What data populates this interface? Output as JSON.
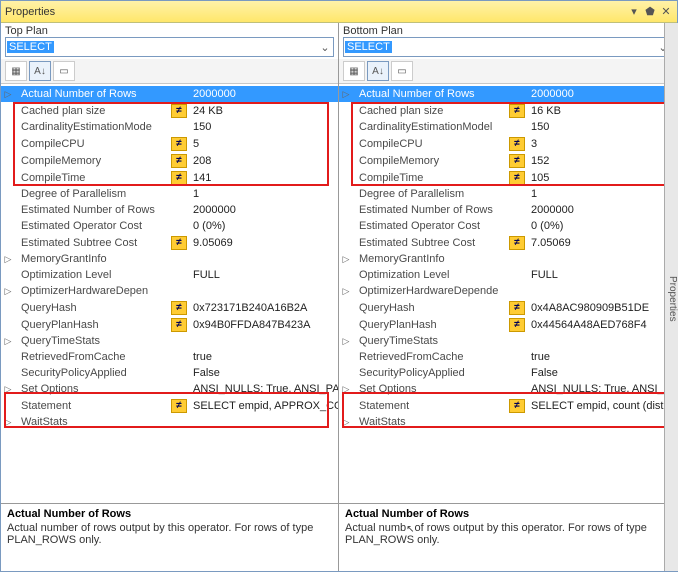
{
  "window": {
    "title": "Properties",
    "side_tab": "Properties"
  },
  "left": {
    "plan_label": "Top Plan",
    "select_value": "SELECT",
    "desc_title": "Actual Number of Rows",
    "desc_body": "Actual number of rows output by this operator. For rows of type PLAN_ROWS only.",
    "props": [
      {
        "exp": "▷",
        "name": "Actual Number of Rows",
        "neq": false,
        "val": "2000000",
        "sel": true
      },
      {
        "exp": "",
        "name": "Cached plan size",
        "neq": true,
        "val": "24 KB"
      },
      {
        "exp": "",
        "name": "CardinalityEstimationMode",
        "neq": false,
        "val": "150"
      },
      {
        "exp": "",
        "name": "CompileCPU",
        "neq": true,
        "val": "5"
      },
      {
        "exp": "",
        "name": "CompileMemory",
        "neq": true,
        "val": "208"
      },
      {
        "exp": "",
        "name": "CompileTime",
        "neq": true,
        "val": "141"
      },
      {
        "exp": "",
        "name": "Degree of Parallelism",
        "neq": false,
        "val": "1"
      },
      {
        "exp": "",
        "name": "Estimated Number of Rows",
        "neq": false,
        "val": "2000000"
      },
      {
        "exp": "",
        "name": "Estimated Operator Cost",
        "neq": false,
        "val": "0 (0%)"
      },
      {
        "exp": "",
        "name": "Estimated Subtree Cost",
        "neq": true,
        "val": "9.05069"
      },
      {
        "exp": "▷",
        "name": "MemoryGrantInfo",
        "neq": false,
        "val": ""
      },
      {
        "exp": "",
        "name": "Optimization Level",
        "neq": false,
        "val": "FULL"
      },
      {
        "exp": "▷",
        "name": "OptimizerHardwareDepen",
        "neq": false,
        "val": ""
      },
      {
        "exp": "",
        "name": "QueryHash",
        "neq": true,
        "val": "0x723171B240A16B2A"
      },
      {
        "exp": "",
        "name": "QueryPlanHash",
        "neq": true,
        "val": "0x94B0FFDA847B423A"
      },
      {
        "exp": "▷",
        "name": "QueryTimeStats",
        "neq": false,
        "val": ""
      },
      {
        "exp": "",
        "name": "RetrievedFromCache",
        "neq": false,
        "val": "true"
      },
      {
        "exp": "",
        "name": "SecurityPolicyApplied",
        "neq": false,
        "val": "False"
      },
      {
        "exp": "▷",
        "name": "Set Options",
        "neq": false,
        "val": "ANSI_NULLS: True, ANSI_PADDIN"
      },
      {
        "exp": "",
        "name": "Statement",
        "neq": true,
        "val": "SELECT empid, APPROX_CO"
      },
      {
        "exp": "▷",
        "name": "WaitStats",
        "neq": false,
        "val": ""
      }
    ]
  },
  "right": {
    "plan_label": "Bottom Plan",
    "select_value": "SELECT",
    "desc_title": "Actual Number of Rows",
    "desc_body_pre": "Actual numb",
    "desc_body_post": "of rows output by this operator. For rows of type PLAN_ROWS only.",
    "props": [
      {
        "exp": "▷",
        "name": "Actual Number of Rows",
        "neq": false,
        "val": "2000000",
        "sel": true
      },
      {
        "exp": "",
        "name": "Cached plan size",
        "neq": true,
        "val": "16 KB"
      },
      {
        "exp": "",
        "name": "CardinalityEstimationModel",
        "neq": false,
        "val": "150"
      },
      {
        "exp": "",
        "name": "CompileCPU",
        "neq": true,
        "val": "3"
      },
      {
        "exp": "",
        "name": "CompileMemory",
        "neq": true,
        "val": "152"
      },
      {
        "exp": "",
        "name": "CompileTime",
        "neq": true,
        "val": "105"
      },
      {
        "exp": "",
        "name": "Degree of Parallelism",
        "neq": false,
        "val": "1"
      },
      {
        "exp": "",
        "name": "Estimated Number of Rows",
        "neq": false,
        "val": "2000000"
      },
      {
        "exp": "",
        "name": "Estimated Operator Cost",
        "neq": false,
        "val": "0 (0%)"
      },
      {
        "exp": "",
        "name": "Estimated Subtree Cost",
        "neq": true,
        "val": "7.05069"
      },
      {
        "exp": "▷",
        "name": "MemoryGrantInfo",
        "neq": false,
        "val": ""
      },
      {
        "exp": "",
        "name": "Optimization Level",
        "neq": false,
        "val": "FULL"
      },
      {
        "exp": "▷",
        "name": "OptimizerHardwareDepende",
        "neq": false,
        "val": ""
      },
      {
        "exp": "",
        "name": "QueryHash",
        "neq": true,
        "val": "0x4A8AC980909B51DE"
      },
      {
        "exp": "",
        "name": "QueryPlanHash",
        "neq": true,
        "val": "0x44564A48AED768F4"
      },
      {
        "exp": "▷",
        "name": "QueryTimeStats",
        "neq": false,
        "val": ""
      },
      {
        "exp": "",
        "name": "RetrievedFromCache",
        "neq": false,
        "val": "true"
      },
      {
        "exp": "",
        "name": "SecurityPolicyApplied",
        "neq": false,
        "val": "False"
      },
      {
        "exp": "▷",
        "name": "Set Options",
        "neq": false,
        "val": "ANSI_NULLS: True, ANSI_PADDING"
      },
      {
        "exp": "",
        "name": "Statement",
        "neq": true,
        "val": "SELECT empid, count (distinct(e"
      },
      {
        "exp": "▷",
        "name": "WaitStats",
        "neq": false,
        "val": ""
      }
    ]
  }
}
